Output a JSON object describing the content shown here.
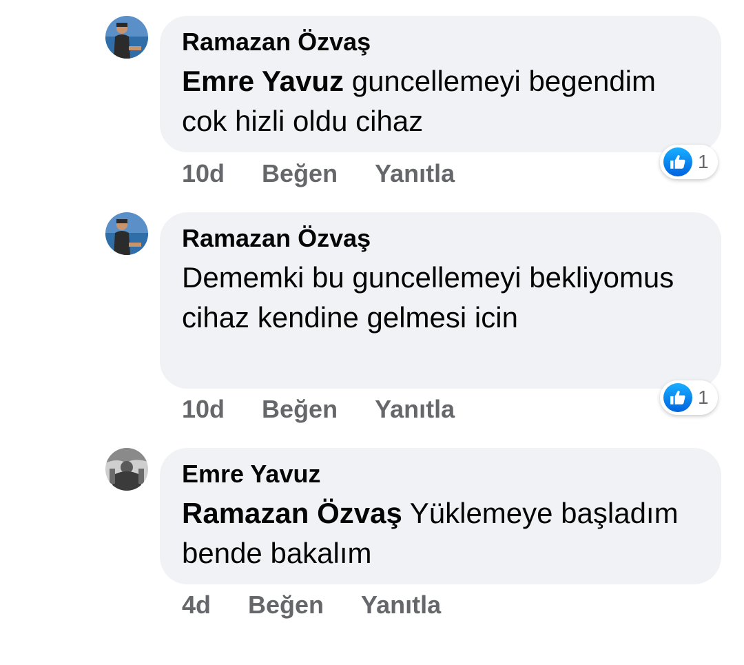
{
  "comments": [
    {
      "author": "Ramazan Özvaş",
      "mention": "Emre Yavuz",
      "text": " guncellemeyi begendim cok hizli oldu cihaz",
      "time": "10d",
      "like_label": "Beğen",
      "reply_label": "Yanıtla",
      "reaction_count": "1",
      "reaction_icon": "thumbs-up-icon",
      "avatar": "avatar-photo"
    },
    {
      "author": "Ramazan Özvaş",
      "mention": "",
      "text": "Dememki bu guncellemeyi bekliyomus cihaz kendine gelmesi icin",
      "time": "10d",
      "like_label": "Beğen",
      "reply_label": "Yanıtla",
      "reaction_count": "1",
      "reaction_icon": "thumbs-up-icon",
      "avatar": "avatar-photo"
    },
    {
      "author": "Emre Yavuz",
      "mention": "Ramazan Özvaş",
      "text": " Yüklemeye başladım bende bakalım",
      "time": "4d",
      "like_label": "Beğen",
      "reply_label": "Yanıtla",
      "avatar": "avatar-photo"
    }
  ],
  "colors": {
    "bubble_bg": "#f0f2f5",
    "meta_text": "#65676b",
    "like_blue": "#0866ff"
  }
}
